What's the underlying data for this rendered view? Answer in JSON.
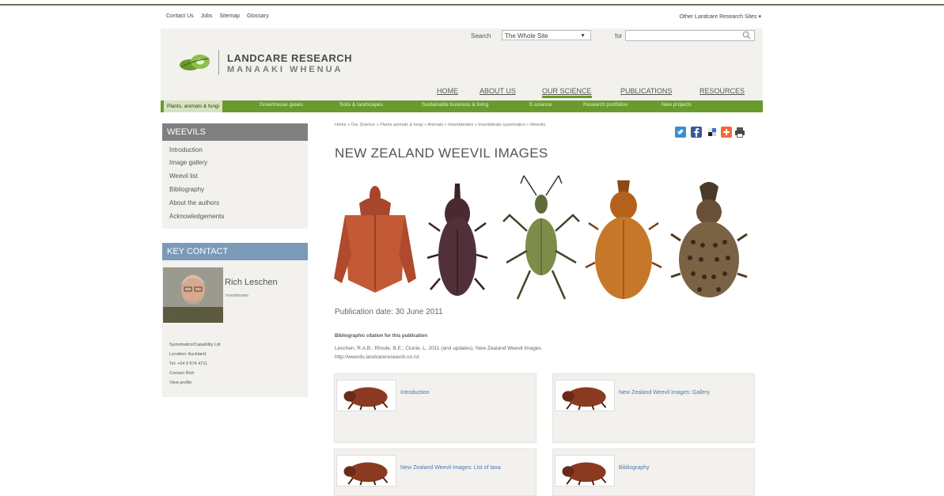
{
  "utility_links": [
    "Contact Us",
    "Jobs",
    "Sitemap",
    "Glossary"
  ],
  "other_sites": "Other Landcare Research Sites ▾",
  "logo": {
    "line1": "LANDCARE RESEARCH",
    "line2": "MANAAKI WHENUA"
  },
  "search": {
    "label": "Search",
    "scope": "The Whole Site",
    "for_label": "for",
    "placeholder": ""
  },
  "main_nav": [
    "HOME",
    "ABOUT US",
    "OUR SCIENCE",
    "PUBLICATIONS",
    "RESOURCES"
  ],
  "sub_nav": [
    "Plants, animals & fungi",
    "Greenhouse gases",
    "Soils & landscapes",
    "Sustainable business & living",
    "E-science",
    "Research portfolios",
    "New projects"
  ],
  "sidebar": {
    "title": "WEEVILS",
    "items": [
      "Introduction",
      "Image gallery",
      "Weevil list",
      "Bibliography",
      "About the authors",
      "Acknowledgements"
    ]
  },
  "key_contact": {
    "title": "KEY CONTACT",
    "name": "Rich Leschen",
    "role": "Invertebrates",
    "capability": "Systematics/Capability Ldr",
    "location": "Location: Auckland",
    "tel": "Tel: +64 9 574 4711",
    "contact_link": "Contact Rich",
    "profile_link": "View profile"
  },
  "breadcrumb": "Home » Our Science » Plants animals & fungi » Animals » Invertebrates » Invertebrate systematics » Weevils",
  "page_title": "NEW ZEALAND WEEVIL IMAGES",
  "pub_date": "Publication date: 30 June 2011",
  "citation_heading": "Bibliographic citation for this publication",
  "citation_text": "Leschen, R.A.B.; Rhode, B.E.; Clunie, L. 2011 (and updates). New Zealand Weevil Images.",
  "citation_url": "http://weevils.landcareresearch.co.nz",
  "cards": [
    {
      "label": "Introduction"
    },
    {
      "label": "New Zealand Weevil Images: Gallery"
    },
    {
      "label": "New Zealand Weevil Images: List of taxa"
    },
    {
      "label": "Bibliography"
    }
  ],
  "colors": {
    "accent_green": "#6a9a2e",
    "sidebar_grey": "#808080",
    "contact_blue": "#7a9ab8",
    "link_blue": "#4a7ab0"
  },
  "share_icons": [
    "twitter-icon",
    "facebook-icon",
    "delicious-icon",
    "addthis-icon",
    "print-icon"
  ]
}
